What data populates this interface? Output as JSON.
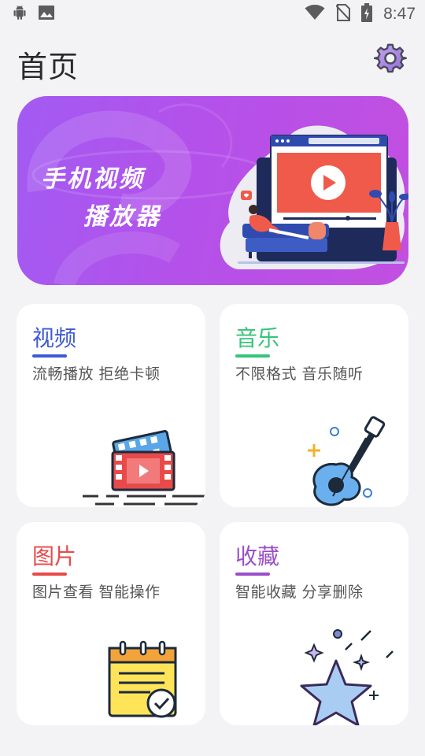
{
  "status_bar": {
    "time": "8:47"
  },
  "header": {
    "title": "首页"
  },
  "banner": {
    "line1": "手机视频",
    "line2": "播放器"
  },
  "cards": [
    {
      "title": "视频",
      "subtitle": "流畅播放 拒绝卡顿",
      "color": "#3f5ad0"
    },
    {
      "title": "音乐",
      "subtitle": "不限格式 音乐随听",
      "color": "#35c47a"
    },
    {
      "title": "图片",
      "subtitle": "图片查看 智能操作",
      "color": "#e84a4a"
    },
    {
      "title": "收藏",
      "subtitle": "智能收藏 分享删除",
      "color": "#9b4fc8"
    }
  ],
  "icons": [
    "android-icon",
    "image-icon",
    "wifi-icon",
    "no-sim-icon",
    "battery-icon",
    "gear-icon",
    "video-film-icon",
    "guitar-icon",
    "notepad-icon",
    "star-icon"
  ]
}
